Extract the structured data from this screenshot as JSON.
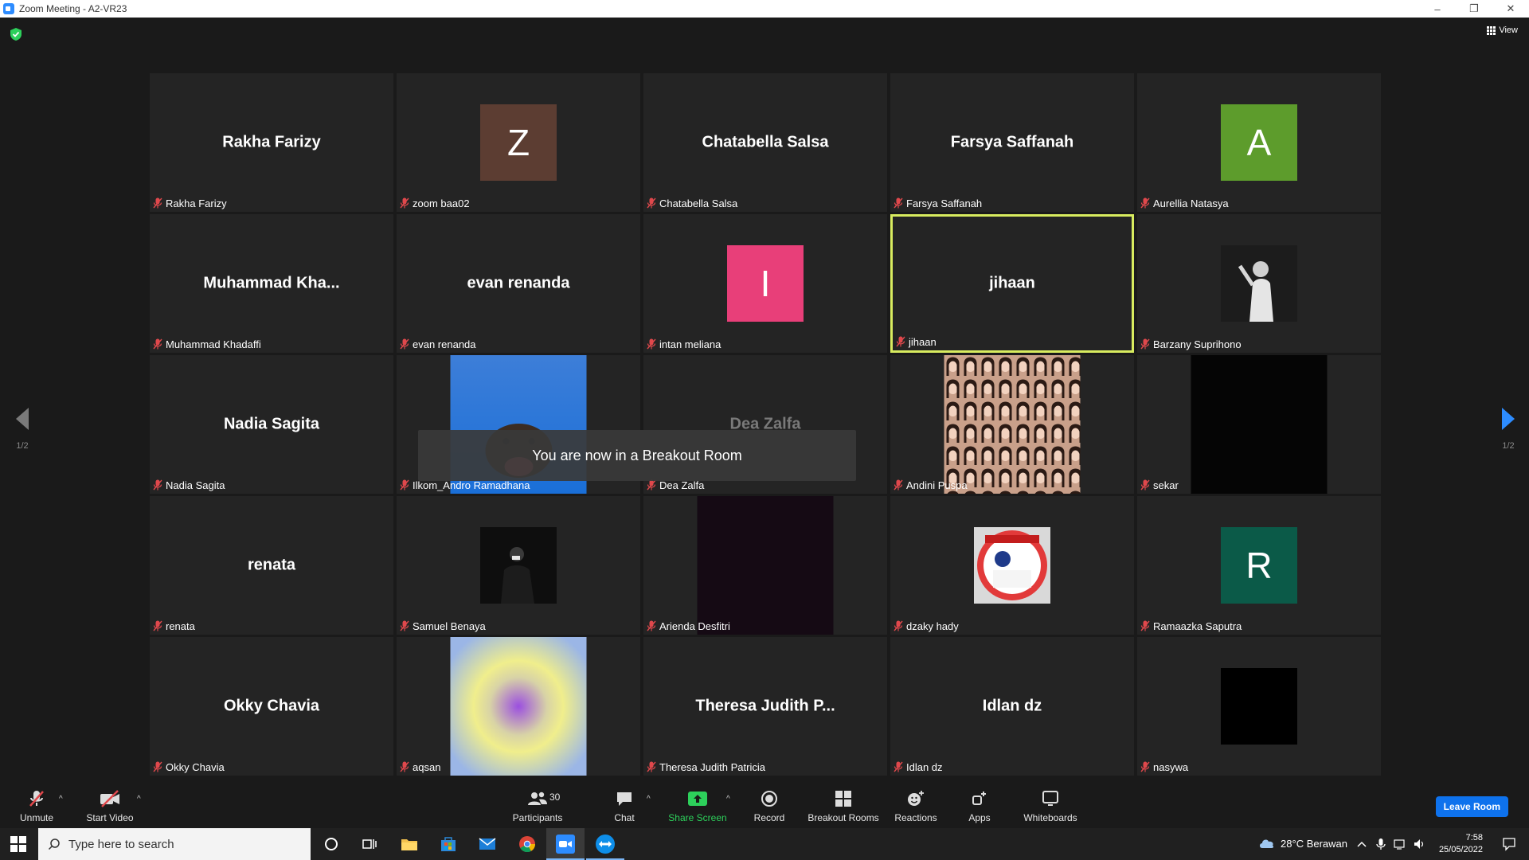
{
  "window": {
    "title": "Zoom Meeting - A2-VR23"
  },
  "top": {
    "view_label": "View"
  },
  "pages": {
    "left": "1/2",
    "right": "1/2"
  },
  "notice": "You are now in a Breakout Room",
  "tiles": [
    {
      "big": "Rakha Farizy",
      "name": "Rakha Farizy"
    },
    {
      "avatar_letter": "Z",
      "avatar_color": "#5c3d32",
      "name": "zoom baa02"
    },
    {
      "big": "Chatabella Salsa",
      "name": "Chatabella Salsa"
    },
    {
      "big": "Farsya Saffanah",
      "name": "Farsya Saffanah"
    },
    {
      "avatar_letter": "A",
      "avatar_color": "#5d9c2c",
      "name": "Aurellia Natasya"
    },
    {
      "big": "Muhammad  Kha...",
      "name": "Muhammad Khadaffi"
    },
    {
      "big": "evan renanda",
      "name": "evan renanda"
    },
    {
      "avatar_letter": "I",
      "avatar_color": "#e83f79",
      "name": "intan meliana"
    },
    {
      "big": "jihaan",
      "name": "jihaan",
      "active": true
    },
    {
      "name": "Barzany Suprihono"
    },
    {
      "big": "Nadia Sagita",
      "name": "Nadia Sagita"
    },
    {
      "name": "Ilkom_Andro Ramadhana"
    },
    {
      "big": "Dea Zalfa",
      "name": "Dea Zalfa"
    },
    {
      "name": "Andini Puspa"
    },
    {
      "name": "sekar"
    },
    {
      "big": "renata",
      "name": "renata"
    },
    {
      "name": "Samuel Benaya"
    },
    {
      "name": "Arienda Desfitri"
    },
    {
      "name": "dzaky hady"
    },
    {
      "avatar_letter": "R",
      "avatar_color": "#0b5a48",
      "name": "Ramaazka Saputra"
    },
    {
      "big": "Okky Chavia",
      "name": "Okky Chavia"
    },
    {
      "name": "aqsan"
    },
    {
      "big": "Theresa Judith P...",
      "name": "Theresa Judith Patricia"
    },
    {
      "big": "Idlan dz",
      "name": "Idlan dz"
    },
    {
      "name": "nasywa"
    }
  ],
  "toolbar": {
    "unmute": "Unmute",
    "start_video": "Start Video",
    "participants": "Participants",
    "participant_count": "30",
    "chat": "Chat",
    "share_screen": "Share Screen",
    "record": "Record",
    "breakout_rooms": "Breakout Rooms",
    "reactions": "Reactions",
    "apps": "Apps",
    "whiteboards": "Whiteboards",
    "leave": "Leave Room"
  },
  "taskbar": {
    "search_placeholder": "Type here to search",
    "weather": "28°C  Berawan",
    "time": "7:58",
    "date": "25/05/2022"
  },
  "colors": {
    "accent_blue": "#0e72ed",
    "active_speaker": "#d8ec5f",
    "green": "#2dd05b",
    "muted_red": "#e0484c"
  }
}
